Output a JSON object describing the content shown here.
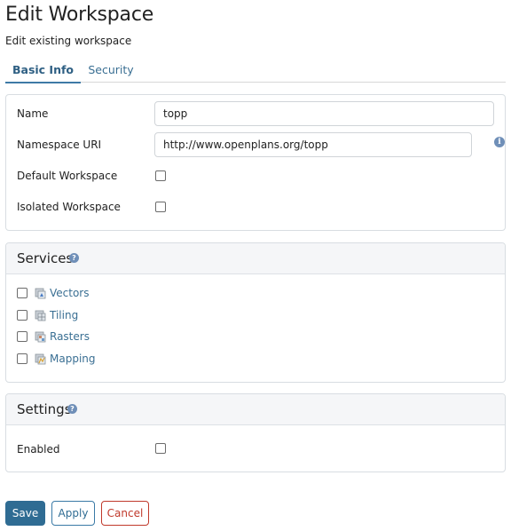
{
  "page": {
    "title": "Edit Workspace",
    "subtitle": "Edit existing workspace"
  },
  "tabs": [
    {
      "label": "Basic Info",
      "active": true
    },
    {
      "label": "Security",
      "active": false
    }
  ],
  "basic": {
    "name_label": "Name",
    "name_value": "topp",
    "namespace_label": "Namespace URI",
    "namespace_value": "http://www.openplans.org/topp",
    "default_label": "Default Workspace",
    "default_checked": false,
    "isolated_label": "Isolated Workspace",
    "isolated_checked": false,
    "info_icon": "info-icon"
  },
  "services": {
    "title": "Services",
    "help_icon": "help-icon",
    "items": [
      {
        "label": "Vectors",
        "checked": false,
        "icon": "vectors-icon"
      },
      {
        "label": "Tiling",
        "checked": false,
        "icon": "tiling-icon"
      },
      {
        "label": "Rasters",
        "checked": false,
        "icon": "rasters-icon"
      },
      {
        "label": "Mapping",
        "checked": false,
        "icon": "mapping-icon"
      }
    ]
  },
  "settings": {
    "title": "Settings",
    "help_icon": "help-icon",
    "enabled_label": "Enabled",
    "enabled_checked": false
  },
  "actions": {
    "save_label": "Save",
    "apply_label": "Apply",
    "cancel_label": "Cancel"
  },
  "colors": {
    "accent": "#2f6c93",
    "link": "#3a6f93",
    "danger": "#c0392b"
  }
}
